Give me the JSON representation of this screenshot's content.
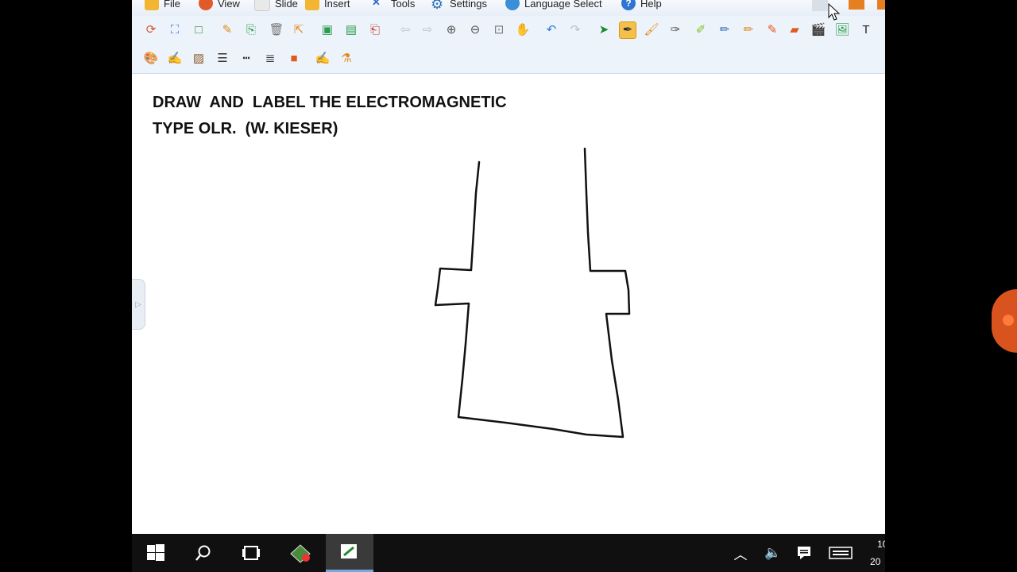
{
  "menubar": {
    "items": [
      {
        "label": "File",
        "icon": "folder-icon",
        "color": "#f2b632"
      },
      {
        "label": "View",
        "icon": "refresh-view-icon",
        "color": "#e15a2b"
      },
      {
        "label": "Slide",
        "icon": "slide-icon",
        "color": "#e4e4e4"
      },
      {
        "label": "Insert",
        "icon": "insert-folder-icon",
        "color": "#f2b632"
      },
      {
        "label": "Tools",
        "icon": "tools-icon",
        "color": "#3366cc"
      },
      {
        "label": "Settings",
        "icon": "gear-icon",
        "color": "#2f6fb5"
      },
      {
        "label": "Language Select",
        "icon": "globe-icon",
        "color": "#3a8fd8"
      },
      {
        "label": "Help",
        "icon": "help-icon",
        "color": "#2f74d0"
      }
    ]
  },
  "toolbar1": {
    "tools": [
      {
        "name": "reload-icon",
        "glyph": "⟳",
        "color": "#d9532b"
      },
      {
        "name": "select-frame-icon",
        "glyph": "⛶",
        "color": "#2a7ed6"
      },
      {
        "name": "rectangle-icon",
        "glyph": "□",
        "color": "#1e8a2e"
      },
      {
        "name": "edit-page-icon",
        "glyph": "✎",
        "color": "#e08a1e"
      },
      {
        "name": "new-page-icon",
        "glyph": "⎘",
        "color": "#2a9d4a"
      },
      {
        "name": "delete-page-icon",
        "glyph": "🗑",
        "color": "#777"
      },
      {
        "name": "export-page-icon",
        "glyph": "⇱",
        "color": "#e08a1e"
      },
      {
        "name": "image-page-icon",
        "glyph": "▣",
        "color": "#2a9d4a"
      },
      {
        "name": "picture-icon",
        "glyph": "▤",
        "color": "#2a9d4a"
      },
      {
        "name": "page-settings-icon",
        "glyph": "⎗",
        "color": "#c0392b"
      },
      {
        "name": "previous-page-icon",
        "glyph": "⇦",
        "color": "#b9c3cf"
      },
      {
        "name": "next-page-icon",
        "glyph": "⇨",
        "color": "#b9c3cf"
      },
      {
        "name": "zoom-in-icon",
        "glyph": "⊕",
        "color": "#555"
      },
      {
        "name": "zoom-out-icon",
        "glyph": "⊖",
        "color": "#555"
      },
      {
        "name": "fit-page-icon",
        "glyph": "⊡",
        "color": "#777"
      },
      {
        "name": "pan-hand-icon",
        "glyph": "✋",
        "color": "#b78b3c"
      },
      {
        "name": "undo-icon",
        "glyph": "↶",
        "color": "#2a7ed6"
      },
      {
        "name": "redo-icon",
        "glyph": "↷",
        "color": "#b9c3cf"
      },
      {
        "name": "pointer-icon",
        "glyph": "➤",
        "color": "#1e8a2e"
      },
      {
        "name": "pen-icon",
        "glyph": "✒",
        "color": "#333",
        "active": true
      },
      {
        "name": "brush-icon",
        "glyph": "🖌",
        "color": "#e08a1e"
      },
      {
        "name": "calligraphy-pen-icon",
        "glyph": "✑",
        "color": "#555"
      },
      {
        "name": "highlighter-icon",
        "glyph": "✐",
        "color": "#7ec224"
      },
      {
        "name": "marker-icon",
        "glyph": "✏",
        "color": "#3b6fb5"
      },
      {
        "name": "pencil-icon",
        "glyph": "✏",
        "color": "#e08a1e"
      },
      {
        "name": "laser-pen-icon",
        "glyph": "✎",
        "color": "#e05a1e"
      },
      {
        "name": "eraser-icon",
        "glyph": "▰",
        "color": "#e05a1e"
      },
      {
        "name": "film-icon",
        "glyph": "🎬",
        "color": "#2a7ed6"
      },
      {
        "name": "insert-image-icon",
        "glyph": "🖼",
        "color": "#2a9d4a"
      },
      {
        "name": "text-tool-icon",
        "glyph": "T",
        "color": "#222"
      }
    ]
  },
  "toolbar2": {
    "tools": [
      {
        "name": "palette-icon",
        "glyph": "🎨",
        "color": "#e08a1e"
      },
      {
        "name": "line-width-icon",
        "glyph": "✍",
        "color": "#555"
      },
      {
        "name": "fill-pattern-icon",
        "glyph": "▨",
        "color": "#8a5a2b"
      },
      {
        "name": "list-icon",
        "glyph": "☰",
        "color": "#333"
      },
      {
        "name": "dash-line-icon",
        "glyph": "┅",
        "color": "#333"
      },
      {
        "name": "align-icon",
        "glyph": "≣",
        "color": "#333"
      },
      {
        "name": "camera-icon",
        "glyph": "■",
        "color": "#e05a1e"
      },
      {
        "name": "signature-pen-icon",
        "glyph": "✍",
        "color": "#555"
      },
      {
        "name": "color-bucket-icon",
        "glyph": "⚗",
        "color": "#e08a1e"
      }
    ]
  },
  "slide": {
    "title_line1": "DRAW  AND  LABEL THE ELECTROMAGNETIC",
    "title_line2": "TYPE OLR.  (W. KIESER)",
    "ink_color": "#111111"
  },
  "taskbar": {
    "start_icon": "windows-start-icon",
    "search_icon": "search-icon",
    "taskview_icon": "task-view-icon",
    "clock_time": "10",
    "clock_date": "20"
  }
}
